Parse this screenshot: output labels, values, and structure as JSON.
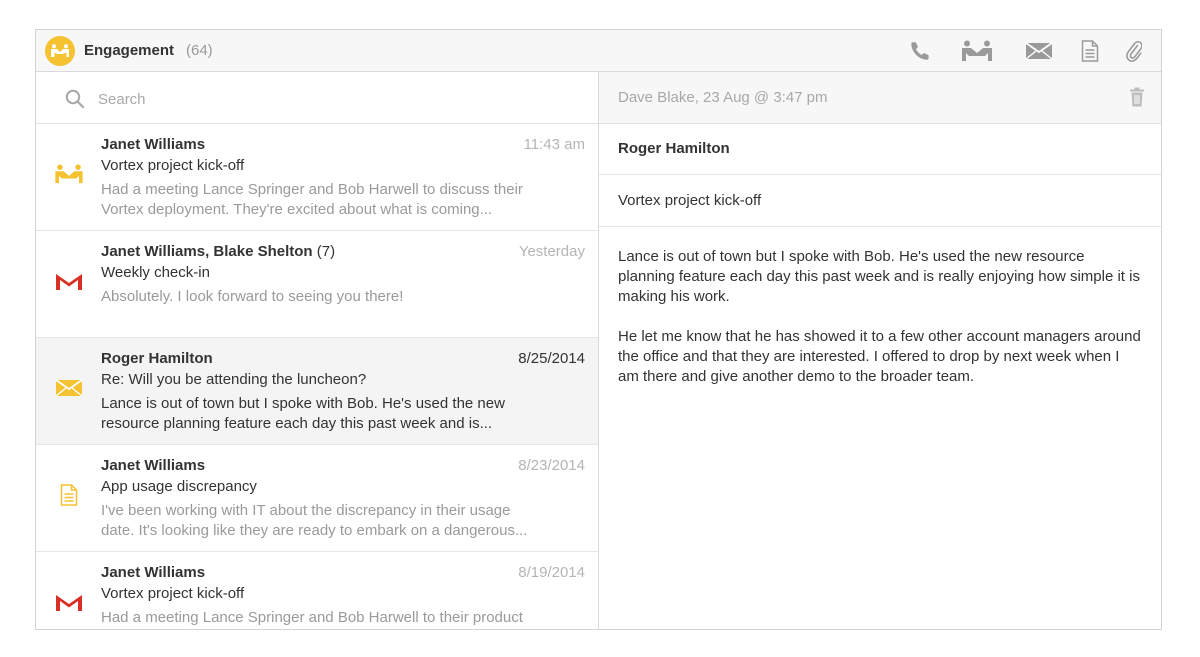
{
  "app": {
    "title": "Engagement",
    "count": "(64)",
    "accent_color": "#f5c231",
    "badge_icon": "handshake-icon"
  },
  "toolbar": {
    "icons": [
      "phone-icon",
      "meeting-icon",
      "email-icon",
      "note-icon",
      "attachment-icon"
    ]
  },
  "search": {
    "placeholder": "Search"
  },
  "messages": [
    {
      "sender": "Janet Williams",
      "count": "",
      "time": "11:43 am",
      "subject": "Vortex project kick-off",
      "snippet1": "Had a meeting Lance Springer and Bob Harwell to discuss their",
      "snippet2": "Vortex deployment. They're excited about what is coming...",
      "icon": "meeting-icon"
    },
    {
      "sender": "Janet Williams, Blake Shelton",
      "count": "(7)",
      "time": "Yesterday",
      "subject": "Weekly check-in",
      "snippet1": "Absolutely. I look forward to seeing you there!",
      "snippet2": "",
      "icon": "gmail-icon"
    },
    {
      "sender": "Roger Hamilton",
      "count": "",
      "time": "8/25/2014",
      "subject": "Re: Will you be attending the luncheon?",
      "snippet1": "Lance is out of town but I spoke with Bob. He's used the new",
      "snippet2": "resource planning feature each day this past week and is...",
      "icon": "email-icon",
      "selected": true
    },
    {
      "sender": "Janet Williams",
      "count": "",
      "time": "8/23/2014",
      "subject": "App usage discrepancy",
      "snippet1": "I've been working with IT about the discrepancy in their usage",
      "snippet2": "date. It's looking like they are ready to embark on a dangerous...",
      "icon": "note-icon"
    },
    {
      "sender": "Janet Williams",
      "count": "",
      "time": "8/19/2014",
      "subject": "Vortex project kick-off",
      "snippet1": "Had a meeting Lance Springer and Bob Harwell to their product",
      "snippet2": "",
      "icon": "gmail-icon"
    }
  ],
  "detail": {
    "meta": "Dave Blake, 23 Aug @ 3:47 pm",
    "name": "Roger Hamilton",
    "subject": "Vortex project kick-off",
    "body": [
      "Lance is out of town but I spoke with Bob. He's used the new resource planning feature each day this past week and is really enjoying how simple it is making his work.",
      "He let me know that he has showed it to a few other account managers around the office and that they are interested. I offered to drop by next week when I am there and give another demo to the broader team."
    ]
  }
}
